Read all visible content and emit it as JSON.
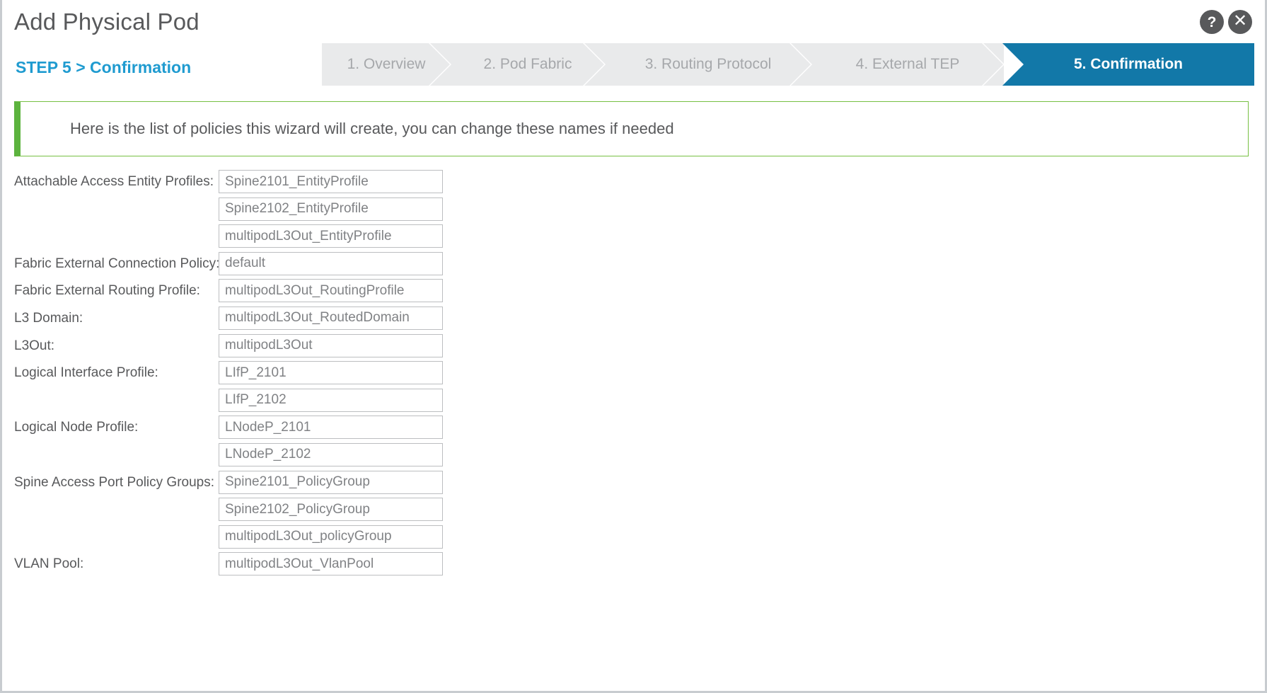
{
  "dialog": {
    "title": "Add Physical Pod",
    "step_label": "STEP 5 > Confirmation"
  },
  "header_icons": {
    "help": {
      "name": "help-icon",
      "glyph": "?"
    },
    "close": {
      "name": "close-icon",
      "glyph": "✕"
    }
  },
  "steps": [
    {
      "label": "1. Overview",
      "active": false
    },
    {
      "label": "2. Pod Fabric",
      "active": false
    },
    {
      "label": "3. Routing Protocol",
      "active": false
    },
    {
      "label": "4. External TEP",
      "active": false
    },
    {
      "label": "5. Confirmation",
      "active": true
    }
  ],
  "banner": {
    "message": "Here is the list of policies this wizard will create, you can change these names if needed",
    "accent_color": "#5cb33e",
    "border_color": "#77c043"
  },
  "colors": {
    "active_step": "#1278a8",
    "step_inactive_bg": "#e9eaeb",
    "step_inactive_text": "#a6a8ab",
    "accent_blue": "#1f9bd0",
    "label_text": "#58595b",
    "input_text": "#808285",
    "input_border": "#bcbec0"
  },
  "form": {
    "rows": [
      {
        "label": "Attachable Access Entity Profiles:",
        "value": "Spine2101_EntityProfile"
      },
      {
        "label": "",
        "value": "Spine2102_EntityProfile"
      },
      {
        "label": "",
        "value": "multipodL3Out_EntityProfile"
      },
      {
        "label": "Fabric External Connection Policy:",
        "value": "default"
      },
      {
        "label": "Fabric External Routing Profile:",
        "value": "multipodL3Out_RoutingProfile"
      },
      {
        "label": "L3 Domain:",
        "value": "multipodL3Out_RoutedDomain"
      },
      {
        "label": "L3Out:",
        "value": "multipodL3Out"
      },
      {
        "label": "Logical Interface Profile:",
        "value": "LIfP_2101"
      },
      {
        "label": "",
        "value": "LIfP_2102"
      },
      {
        "label": "Logical Node Profile:",
        "value": "LNodeP_2101"
      },
      {
        "label": "",
        "value": "LNodeP_2102"
      },
      {
        "label": "Spine Access Port Policy Groups:",
        "value": "Spine2101_PolicyGroup"
      },
      {
        "label": "",
        "value": "Spine2102_PolicyGroup"
      },
      {
        "label": "",
        "value": "multipodL3Out_policyGroup"
      },
      {
        "label": "VLAN Pool:",
        "value": "multipodL3Out_VlanPool"
      }
    ]
  }
}
